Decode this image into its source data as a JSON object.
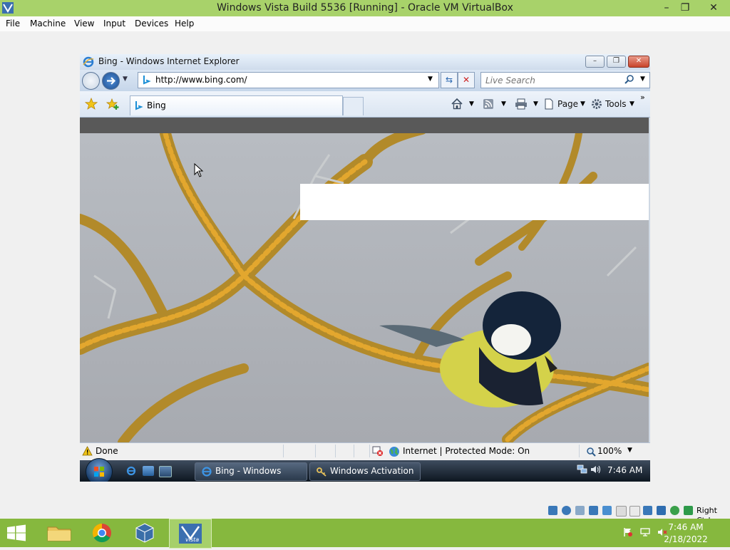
{
  "host": {
    "title": "Windows Vista Build 5536 [Running] - Oracle VM VirtualBox",
    "menu": [
      "File",
      "Machine",
      "View",
      "Input",
      "Devices",
      "Help"
    ],
    "host_key": "Right Ctrl",
    "accent": "#a8d26a"
  },
  "ie": {
    "title": "Bing - Windows Internet Explorer",
    "address": "http://www.bing.com/",
    "search_placeholder": "Live Search",
    "tab_label": "Bing",
    "toolbar": {
      "page": "Page",
      "tools": "Tools"
    }
  },
  "status": {
    "done": "Done",
    "zone": "Internet | Protected Mode: On",
    "zoom": "100%"
  },
  "vista": {
    "tasks": [
      "Bing - Windows Inte...",
      "Windows Activation"
    ],
    "clock": "7:46 AM"
  },
  "host_taskbar": {
    "clock_time": "7:46 AM",
    "clock_date": "2/18/2022",
    "start_badge": "vista"
  }
}
